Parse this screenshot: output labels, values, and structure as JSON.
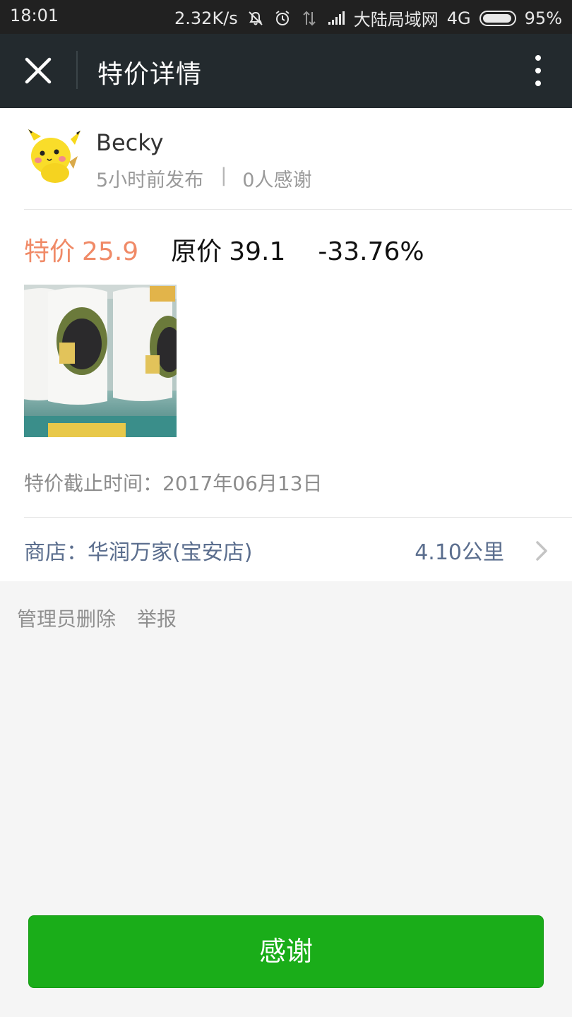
{
  "status_bar": {
    "time": "18:01",
    "speed": "2.32K/s",
    "carrier": "大陆局域网",
    "network": "4G",
    "battery_percent": "95%",
    "battery_level": 0.95
  },
  "nav": {
    "title": "特价详情"
  },
  "post": {
    "username": "Becky",
    "posted_ago": "5小时前发布",
    "separator": "|",
    "thanks_count": "0人感谢"
  },
  "price": {
    "special_label": "特价",
    "special_value": "25.9",
    "original_label": "原价",
    "original_value": "39.1",
    "discount": "-33.76%"
  },
  "deadline": {
    "label": "特价截止时间：",
    "date": "2017年06月13日"
  },
  "store": {
    "label": "商店：",
    "name": "华润万家(宝安店)",
    "distance": "4.10公里"
  },
  "actions": {
    "delete": "管理员删除",
    "report": "举报"
  },
  "thanks_button": "感谢",
  "colors": {
    "special_price": "#f08a67",
    "link_blue": "#5b6e8e",
    "primary_green": "#1aad19",
    "nav_bg": "#232a2e"
  }
}
